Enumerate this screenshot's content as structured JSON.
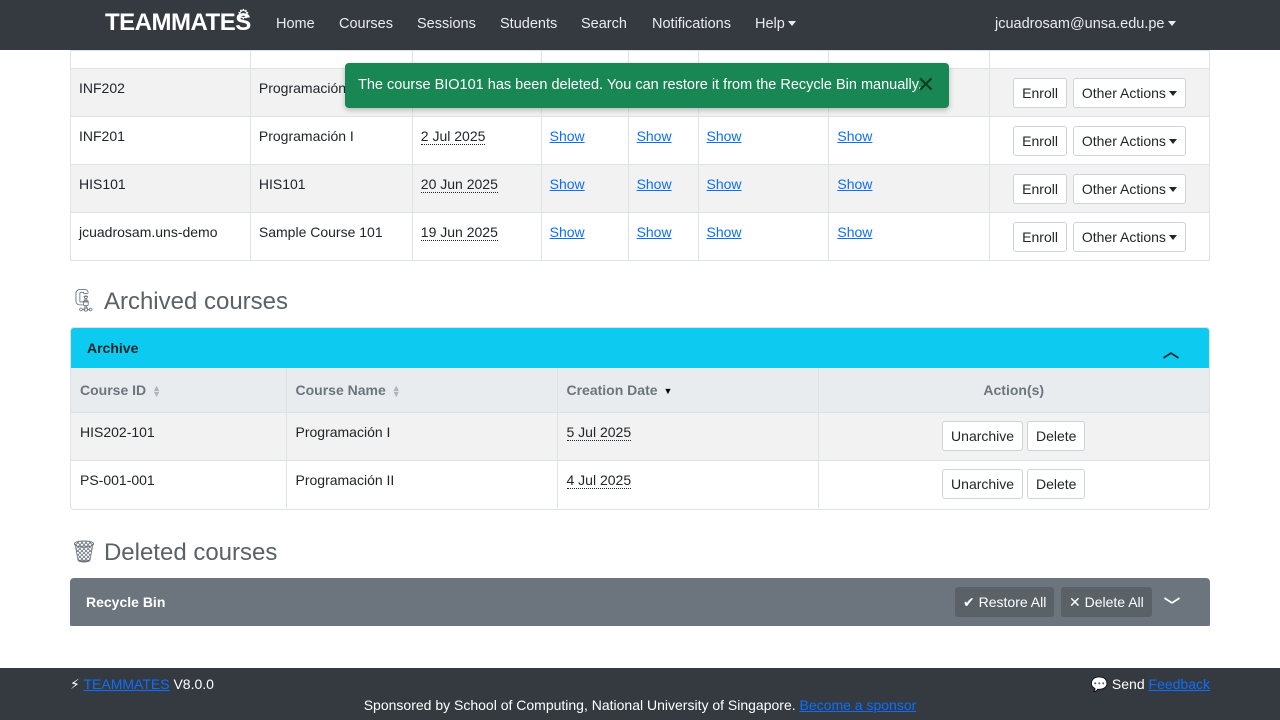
{
  "nav": {
    "brand": "TEAMMATES",
    "items": [
      "Home",
      "Courses",
      "Sessions",
      "Students",
      "Search",
      "Notifications"
    ],
    "help": "Help",
    "user": "jcuadrosam@unsa.edu.pe"
  },
  "toast": {
    "message": "The course BIO101 has been deleted. You can restore it from the Recycle Bin manually."
  },
  "active_courses": {
    "link_label": "Show",
    "enroll_label": "Enroll",
    "other_actions_label": "Other Actions",
    "rows": [
      {
        "id": "INF202",
        "name": "Programación II",
        "date": ""
      },
      {
        "id": "INF201",
        "name": "Programación I",
        "date": "2 Jul 2025"
      },
      {
        "id": "HIS101",
        "name": "HIS101",
        "date": "20 Jun 2025"
      },
      {
        "id": "jcuadrosam.uns-demo",
        "name": "Sample Course 101",
        "date": "19 Jun 2025"
      }
    ]
  },
  "archived": {
    "title": "Archived courses",
    "card_title": "Archive",
    "headers": {
      "id": "Course ID",
      "name": "Course Name",
      "date": "Creation Date",
      "actions": "Action(s)"
    },
    "unarchive_label": "Unarchive",
    "delete_label": "Delete",
    "rows": [
      {
        "id": "HIS202-101",
        "name": "Programación I",
        "date": "5 Jul 2025"
      },
      {
        "id": "PS-001-001",
        "name": "Programación II",
        "date": "4 Jul 2025"
      }
    ]
  },
  "deleted": {
    "title": "Deleted courses",
    "card_title": "Recycle Bin",
    "restore_all": "Restore All",
    "delete_all": "Delete All"
  },
  "footer": {
    "brand": "TEAMMATES",
    "version": "V8.0.0",
    "send": "Send",
    "feedback": "Feedback",
    "sponsor_text": "Sponsored by School of Computing, National University of Singapore.",
    "sponsor_link": "Become a sponsor"
  },
  "colors": {
    "navbar": "#343a40",
    "toast": "#198754",
    "archive_header": "#0dcaf0",
    "recycle_header": "#6c757d"
  }
}
